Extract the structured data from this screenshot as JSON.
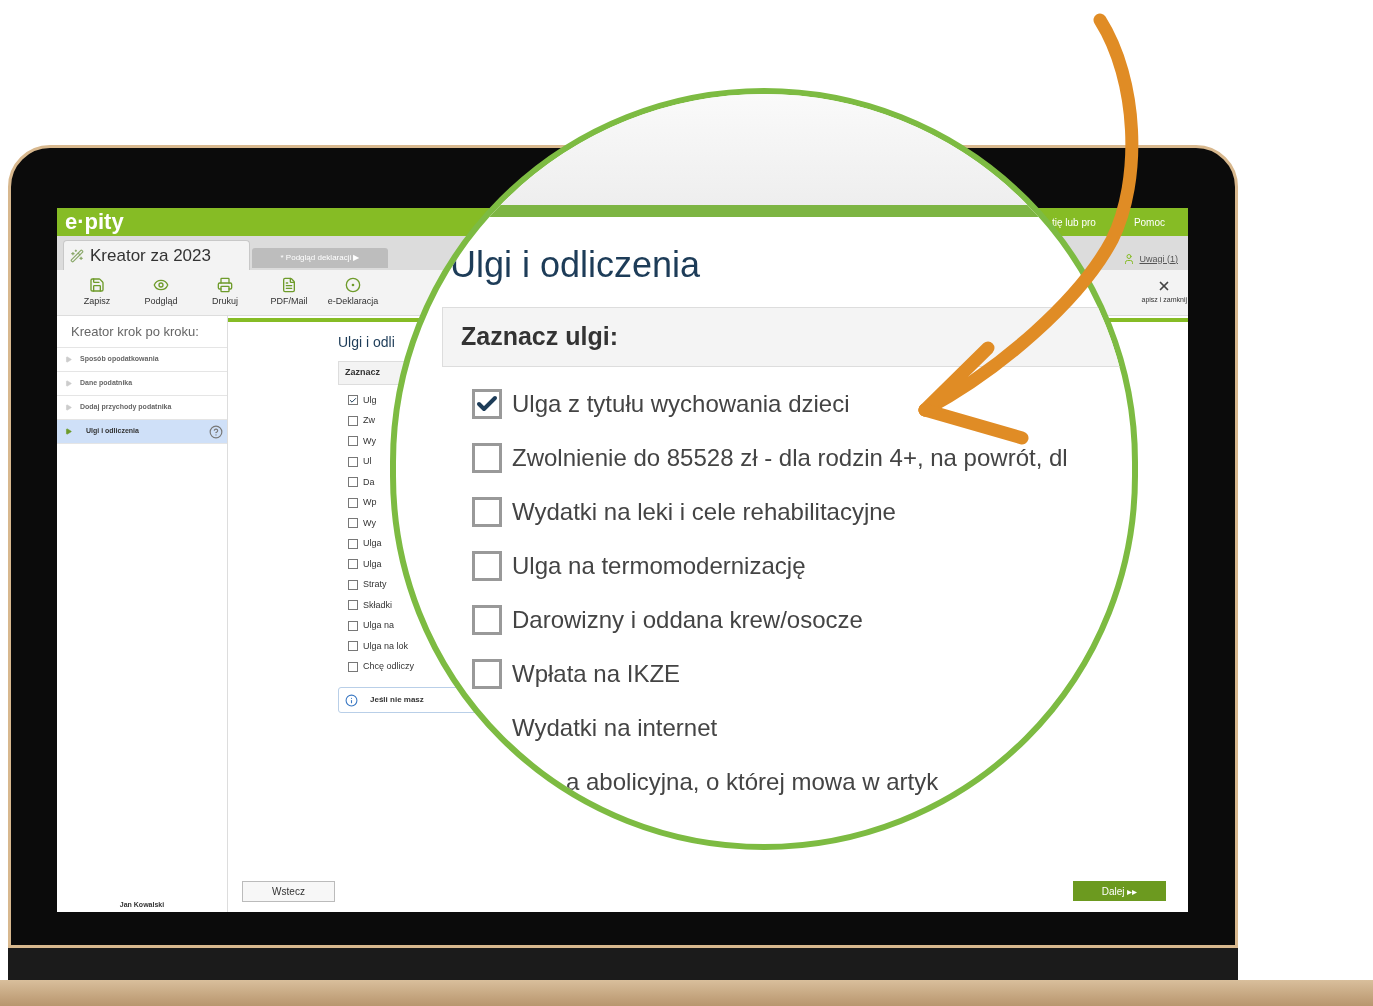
{
  "app": {
    "logo": "e·pity",
    "header_links": [
      "tię lub pro",
      "Pomoc"
    ]
  },
  "tabs": [
    {
      "label": "Kreator za 2023",
      "selected": true
    },
    {
      "label": "* Podgląd deklaracji ▶",
      "selected": false
    }
  ],
  "notes_link": "Uwagi (1)",
  "toolbar": [
    "Zapisz",
    "Podgląd",
    "Drukuj",
    "PDF/Mail",
    "e-Deklaracja"
  ],
  "close_action": "apisz i zamknij",
  "sidebar": {
    "title": "Kreator krok po kroku:",
    "items": [
      {
        "label": "Sposób opodatkowania",
        "selected": false
      },
      {
        "label": "Dane podatnika",
        "selected": false
      },
      {
        "label": "Dodaj przychody podatnika",
        "selected": false
      },
      {
        "label": "Ulgi i odliczenia",
        "selected": true
      }
    ],
    "user": "Jan Kowalski"
  },
  "form": {
    "title": "Ulgi i odli",
    "section": "Zaznacz",
    "options": [
      {
        "label": "Ulg",
        "checked": true
      },
      {
        "label": "Zw",
        "checked": false
      },
      {
        "label": "Wy",
        "checked": false
      },
      {
        "label": "Ul",
        "checked": false
      },
      {
        "label": "Da",
        "checked": false
      },
      {
        "label": "Wp",
        "checked": false
      },
      {
        "label": "Wy",
        "checked": false
      },
      {
        "label": "Ulga",
        "checked": false
      },
      {
        "label": "Ulga",
        "checked": false
      },
      {
        "label": "Straty",
        "checked": false
      },
      {
        "label": "Składki",
        "checked": false
      },
      {
        "label": "Ulga na",
        "checked": false
      },
      {
        "label": "Ulga na lok",
        "checked": false
      },
      {
        "label": "Chcę odliczy",
        "checked": false
      }
    ],
    "info": "Jeśli nie masz"
  },
  "buttons": {
    "back": "Wstecz",
    "next": "Dalej ▸▸"
  },
  "magnifier": {
    "title": "Ulgi i odliczenia",
    "section": "Zaznacz ulgi:",
    "options": [
      {
        "label": "Ulga z tytułu wychowania dzieci",
        "checked": true
      },
      {
        "label": "Zwolnienie do 85528 zł - dla rodzin 4+, na powrót, dl",
        "checked": false
      },
      {
        "label": "Wydatki na leki i cele rehabilitacyjne",
        "checked": false
      },
      {
        "label": "Ulga na termomodernizację",
        "checked": false
      },
      {
        "label": "Darowizny i oddana krew/osocze",
        "checked": false
      },
      {
        "label": "Wpłata na IKZE",
        "checked": false
      },
      {
        "label": "Wydatki na internet"
      },
      {
        "label": "a abolicyjna, o której mowa w artyk"
      }
    ]
  }
}
